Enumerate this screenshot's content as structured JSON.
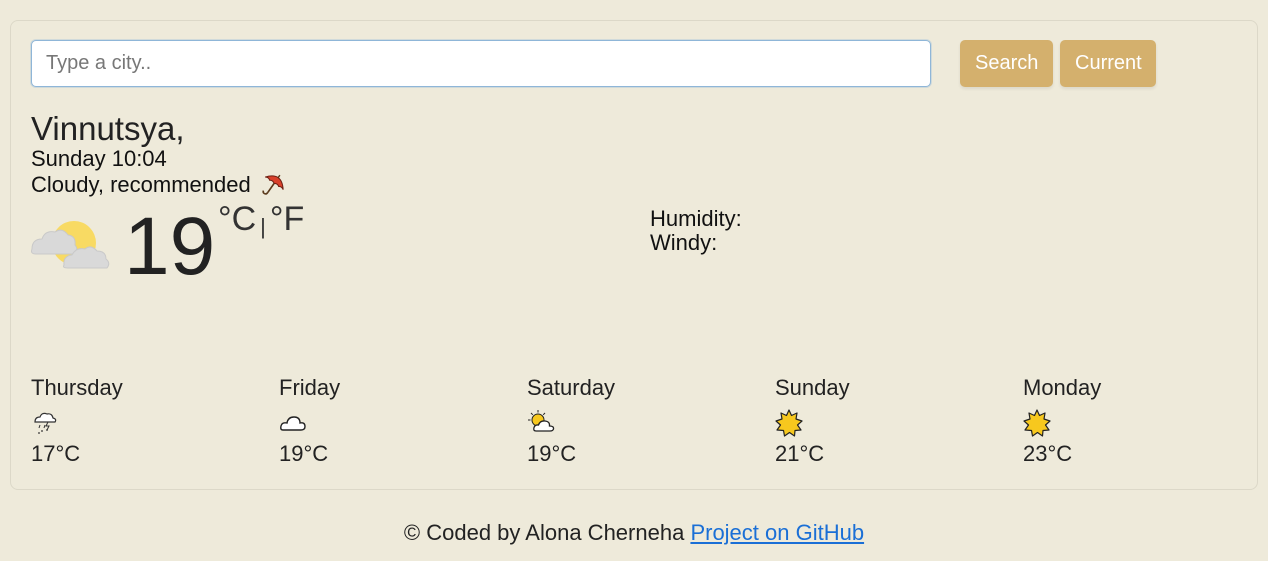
{
  "search": {
    "placeholder": "Type a city..",
    "value": "",
    "search_label": "Search",
    "current_label": "Current"
  },
  "current": {
    "city": "Vinnutsya,",
    "datetime": "Sunday 10:04",
    "description": "Cloudy, recommended",
    "recommend_icon": "umbrella-icon",
    "weather_icon": "sun-behind-clouds-icon",
    "temperature": "19",
    "unit_celsius": "°C",
    "unit_separator": "|",
    "unit_fahrenheit": "°F",
    "humidity_label": "Humidity:",
    "wind_label": "Windy:"
  },
  "forecast": [
    {
      "day": "Thursday",
      "icon": "rain-snow-cloud-icon",
      "temp": "17°C"
    },
    {
      "day": "Friday",
      "icon": "cloud-icon",
      "temp": "19°C"
    },
    {
      "day": "Saturday",
      "icon": "sun-behind-cloud-icon",
      "temp": "19°C"
    },
    {
      "day": "Sunday",
      "icon": "sun-icon",
      "temp": "21°C"
    },
    {
      "day": "Monday",
      "icon": "sun-icon",
      "temp": "23°C"
    }
  ],
  "footer": {
    "text": "© Coded by Alona Cherneha",
    "link_text": "Project on GitHub"
  },
  "colors": {
    "background": "#eeeada",
    "button": "#d4b06d",
    "link": "#1a6fd6"
  }
}
